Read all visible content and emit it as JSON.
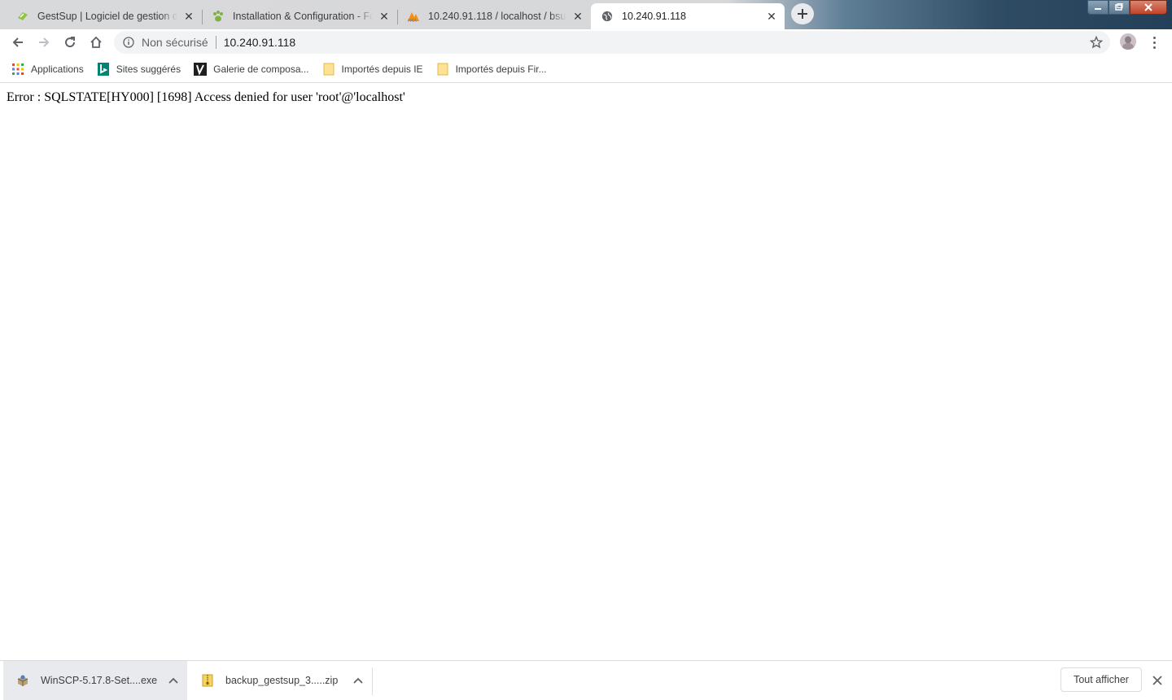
{
  "tabs": [
    {
      "title": "GestSup | Logiciel de gestion de",
      "favicon": "gestsup-icon",
      "active": false
    },
    {
      "title": "Installation & Configuration - For",
      "favicon": "paw-icon",
      "active": false
    },
    {
      "title": "10.240.91.118 / localhost / bsup |",
      "favicon": "phpmyadmin-icon",
      "active": false
    },
    {
      "title": "10.240.91.118",
      "favicon": "globe-icon",
      "active": true
    }
  ],
  "toolbar": {
    "security_label": "Non sécurisé",
    "url": "10.240.91.118"
  },
  "bookmarks": [
    {
      "label": "Applications",
      "icon": "apps-grid-icon"
    },
    {
      "label": "Sites suggérés",
      "icon": "bing-icon"
    },
    {
      "label": "Galerie de composa...",
      "icon": "gallery-icon"
    },
    {
      "label": "Importés depuis IE",
      "icon": "folder-icon"
    },
    {
      "label": "Importés depuis Fir...",
      "icon": "folder-icon"
    }
  ],
  "page": {
    "error_text": "Error : SQLSTATE[HY000] [1698] Access denied for user 'root'@'localhost'"
  },
  "downloads": {
    "items": [
      {
        "filename": "WinSCP-5.17.8-Set....exe",
        "icon": "installer-icon"
      },
      {
        "filename": "backup_gestsup_3.....zip",
        "icon": "zip-icon"
      }
    ],
    "show_all_label": "Tout afficher"
  },
  "colors": {
    "tab_strip": "#d8d9db",
    "omnibox_bg": "#f1f3f4",
    "window_close": "#c1442a"
  }
}
